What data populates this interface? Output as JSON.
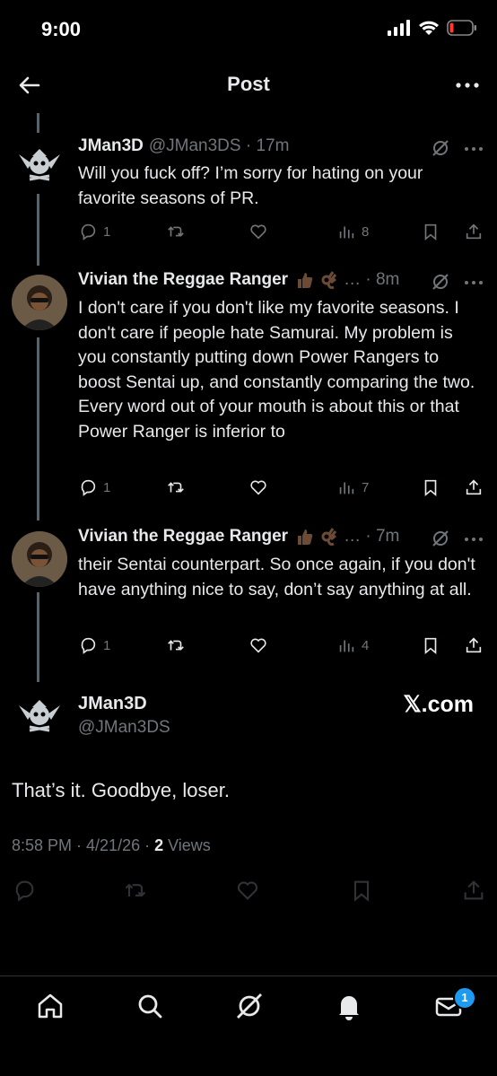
{
  "status_bar": {
    "time": "9:00"
  },
  "header": {
    "title": "Post"
  },
  "tweets": [
    {
      "name": "JMan3D",
      "meta": "@JMan3DS · 17m",
      "text": "Will you fuck off? I’m sorry for hating on your favorite seasons of PR.",
      "replies": "1",
      "retweets": "",
      "likes": "",
      "views": "8"
    },
    {
      "name": "Vivian the Reggae Ranger",
      "meta": "… · 8m",
      "text": "I don't care if you don't like my favorite seasons. I don't care if people hate Samurai. My problem is you constantly putting down Power Rangers to boost Sentai up, and constantly comparing the two. Every word out of your mouth is about this or that Power Ranger is inferior to",
      "replies": "1",
      "retweets": "",
      "likes": "",
      "views": "7"
    },
    {
      "name": "Vivian the Reggae Ranger",
      "meta": "… · 7m",
      "text": "their Sentai counterpart. So once again, if you don't have anything nice to say, don’t say anything at all.",
      "replies": "1",
      "retweets": "",
      "likes": "",
      "views": "4"
    }
  ],
  "main_post": {
    "name": "JMan3D",
    "handle": "@JMan3DS",
    "watermark": "𝕏.com",
    "text": "That’s it. Goodbye, loser.",
    "meta_prefix": "8:58 PM · 4/21/26 · ",
    "views_count": "2",
    "views_label": " Views"
  },
  "bottom_nav": {
    "items": [
      "home-icon",
      "search-icon",
      "grok-icon",
      "notifications-icon",
      "messages-icon"
    ],
    "messages_badge": "1"
  },
  "colors": {
    "background": "#000000",
    "text": "#e7e9ea",
    "muted": "#71767b",
    "accent": "#1d9bf0"
  }
}
